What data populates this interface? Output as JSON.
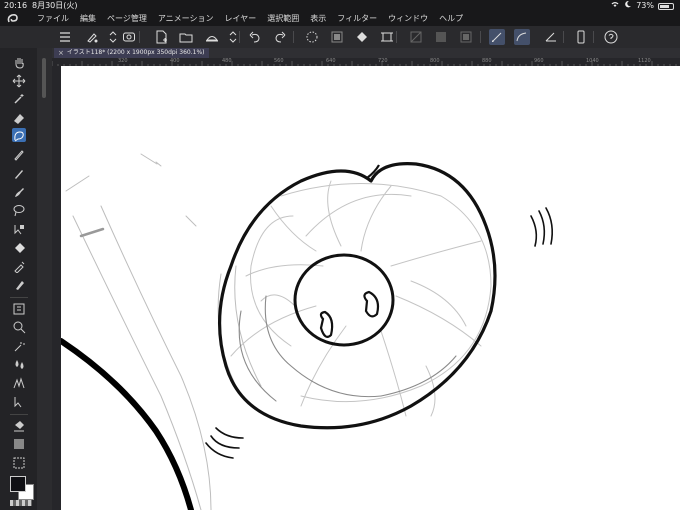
{
  "status_bar": {
    "time": "20:16",
    "date": "8月30日(火)",
    "battery": "73%",
    "battery_level": 0.73
  },
  "menu": {
    "items": [
      "ファイル",
      "編集",
      "ページ管理",
      "アニメーション",
      "レイヤー",
      "選択範囲",
      "表示",
      "フィルター",
      "ウィンドウ",
      "ヘルプ"
    ]
  },
  "document": {
    "tab_label": "イラスト118* (2200 x 1900px 350dpi 360.1%)"
  },
  "ruler": {
    "marks": [
      "320",
      "400",
      "480",
      "560",
      "640",
      "720",
      "800",
      "880",
      "960",
      "1040",
      "1120"
    ]
  },
  "colors": {
    "accent": "#3b6fb3",
    "toolbar_active": "#44506a",
    "foreground_color": "#101014",
    "background_color": "#ffffff"
  },
  "tools": [
    "hand-icon",
    "move-icon",
    "magic-wand-icon",
    "eraser-icon",
    "select-lasso-icon",
    "pen-icon",
    "pencil-icon",
    "brush-icon",
    "lasso-icon",
    "auto-select-icon",
    "fill-icon",
    "eyedropper-icon",
    "marker-icon",
    "layer-icon",
    "zoom-icon",
    "airbrush-icon",
    "water-icon",
    "decorate-icon",
    "object-icon",
    "bucket-icon",
    "gradient-icon",
    "blend-icon"
  ],
  "toolbar_icons": [
    "menu-icon",
    "brush-settings-icon",
    "updown-icon",
    "preview-icon",
    "new-icon",
    "open-icon",
    "save-icon",
    "updown2-icon",
    "undo-icon",
    "redo-icon",
    "spinner-icon",
    "clear-icon",
    "fill-icon",
    "transform-icon",
    "gray1-icon",
    "gray2-icon",
    "gray3-icon",
    "ruler-snap-icon",
    "curve-snap-icon",
    "perspective-icon",
    "device-icon",
    "help-icon"
  ]
}
